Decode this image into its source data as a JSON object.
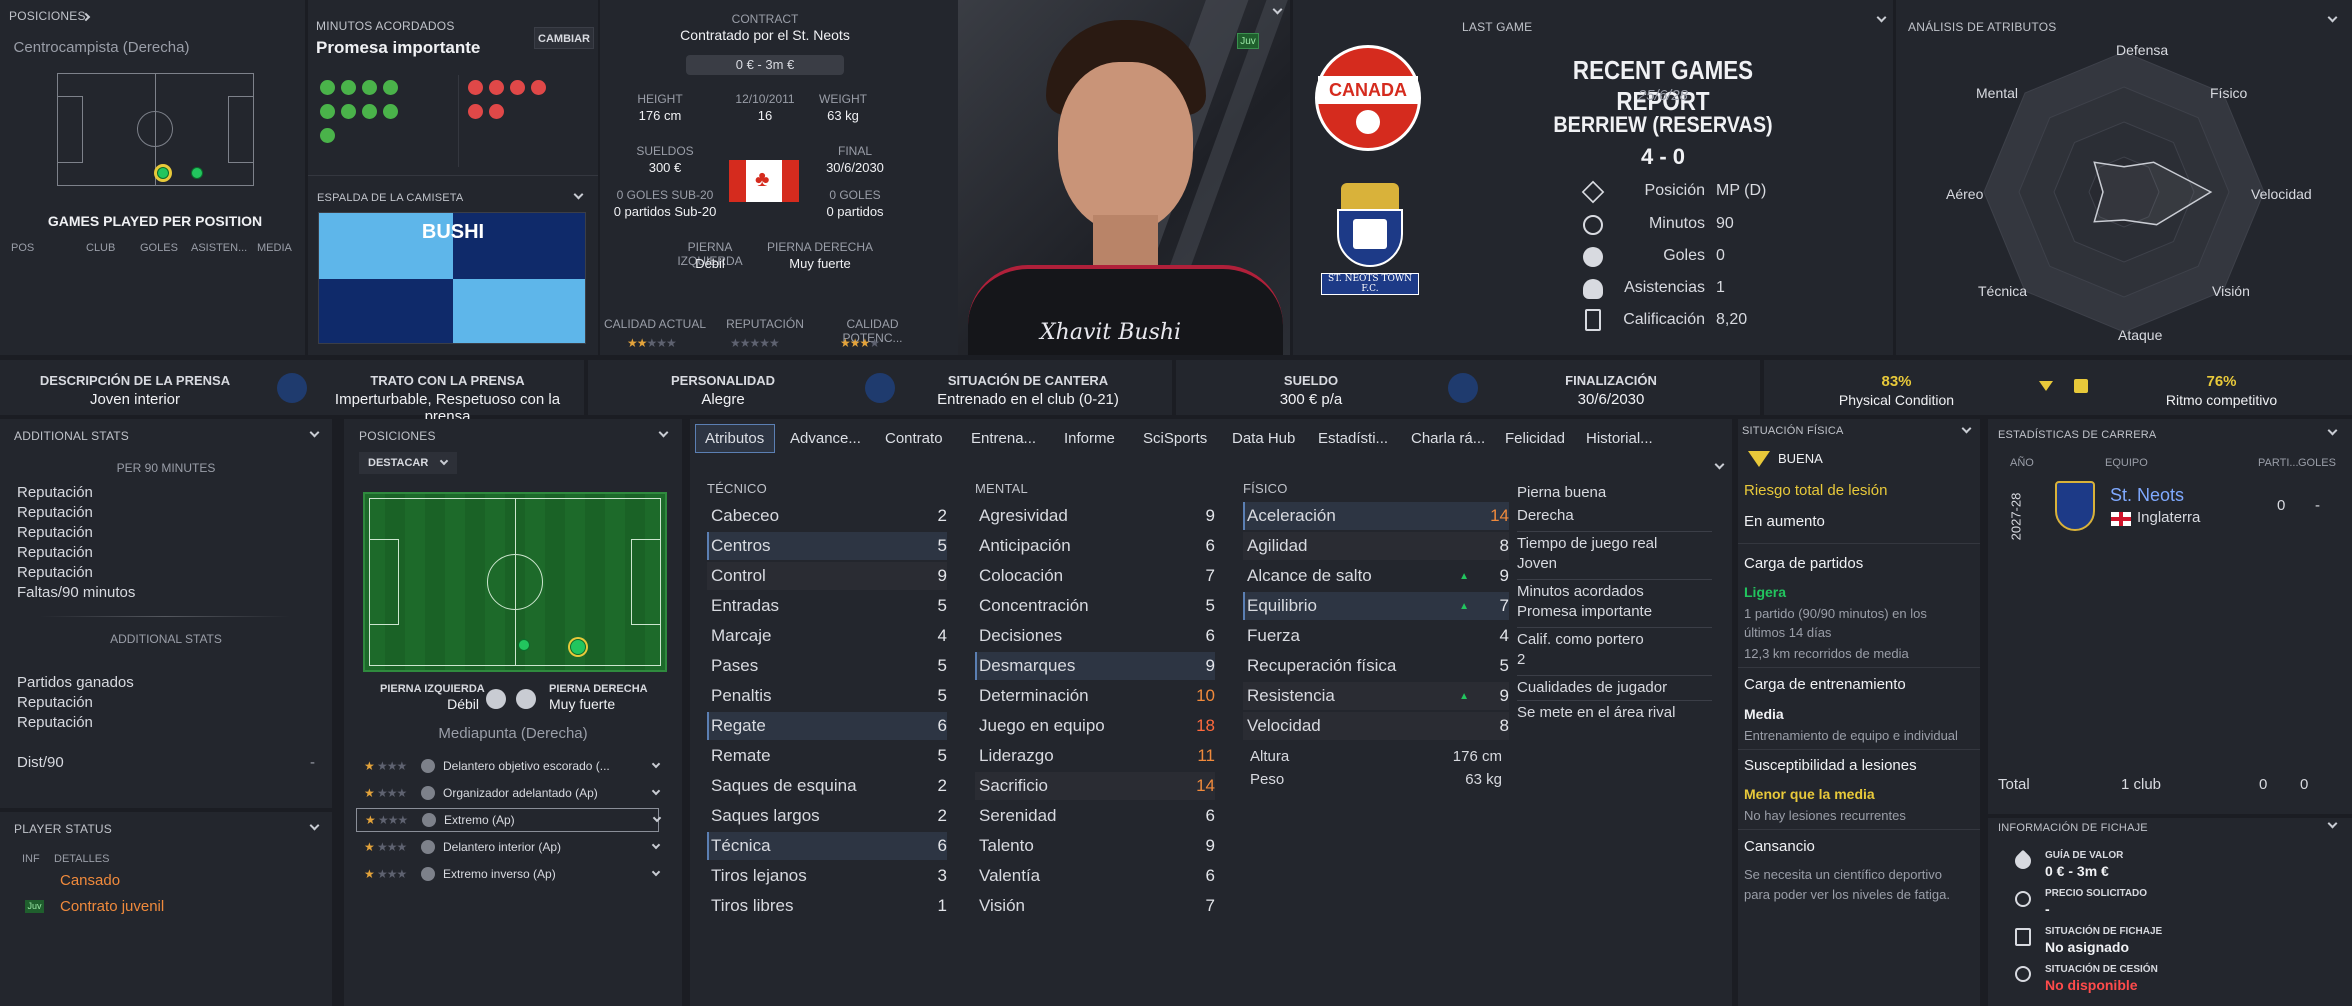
{
  "positions_panel": {
    "title": "POSICIONES",
    "position_name": "Centrocampista (Derecha)",
    "games_per_position": "GAMES PLAYED PER POSITION",
    "cols": [
      "POS",
      "CLUB",
      "GOLES",
      "ASISTEN...",
      "MEDIA"
    ]
  },
  "minutes": {
    "title": "MINUTOS ACORDADOS",
    "value": "Promesa importante",
    "change_button": "CAMBIAR"
  },
  "shirt": {
    "title": "ESPALDA DE LA CAMISETA",
    "name": "BUSHI"
  },
  "contract": {
    "title": "CONTRACT",
    "club_line": "Contratado por el St. Neots",
    "value_pill": "0 € - 3m €",
    "height_label": "HEIGHT",
    "height": "176 cm",
    "dob_label": "12/10/2011",
    "age": "16",
    "weight_label": "WEIGHT",
    "weight": "63 kg",
    "wage_label": "SUELDOS",
    "wage": "300 €",
    "end_label": "FINAL",
    "end": "30/6/2030",
    "u20_label": "0 GOLES SUB-20",
    "u20_value": "0 partidos Sub-20",
    "goals_label": "0 GOLES",
    "goals_value": "0 partidos",
    "left_foot_label": "PIERNA IZQUIERDA",
    "left_foot": "Débil",
    "right_foot_label": "PIERNA DERECHA",
    "right_foot": "Muy fuerte",
    "ca_label": "CALIDAD ACTUAL",
    "rep_label": "REPUTACIÓN",
    "pa_label": "CALIDAD POTENC..."
  },
  "photo": {
    "badge": "Juv",
    "signature": "Xhavit Bushi"
  },
  "last_game": {
    "title": "LAST GAME",
    "heading": "RECENT GAMES REPORT",
    "date": "25/6/28",
    "opponent": "BERRIEW (RESERVAS)",
    "score": "4 - 0",
    "rows": [
      {
        "label": "Posición",
        "value": "MP (D)"
      },
      {
        "label": "Minutos",
        "value": "90"
      },
      {
        "label": "Goles",
        "value": "0"
      },
      {
        "label": "Asistencias",
        "value": "1"
      },
      {
        "label": "Calificación",
        "value": "8,20"
      }
    ],
    "canada_text": "CANADA",
    "club_crest_text": "ST. NEOTS TOWN F.C."
  },
  "attr_analysis": {
    "title": "ANÁLISIS DE ATRIBUTOS",
    "labels": [
      "Defensa",
      "Físico",
      "Velocidad",
      "Visión",
      "Ataque",
      "Técnica",
      "Aéreo",
      "Mental"
    ],
    "values": [
      0.18,
      0.3,
      0.62,
      0.33,
      0.2,
      0.3,
      0.15,
      0.3
    ]
  },
  "info_bar": {
    "press_label": "DESCRIPCIÓN DE LA PRENSA",
    "press": "Joven interior",
    "press_treat_label": "TRATO CON LA PRENSA",
    "press_treat": "Imperturbable, Respetuoso con la prensa",
    "personality_label": "PERSONALIDAD",
    "personality": "Alegre",
    "youth_label": "SITUACIÓN DE CANTERA",
    "youth": "Entrenado en el club (0-21)",
    "salary_label": "SUELDO",
    "salary": "300 € p/a",
    "expiry_label": "FINALIZACIÓN",
    "expiry": "30/6/2030",
    "condition_pct": "83%",
    "condition_label": "Physical Condition",
    "sharp_pct": "76%",
    "sharp_label": "Ritmo competitivo"
  },
  "additional_stats": {
    "title": "ADDITIONAL STATS",
    "sub1": "PER 90 MINUTES",
    "items1": [
      "Reputación",
      "Reputación",
      "Reputación",
      "Reputación",
      "Reputación",
      "Faltas/90 minutos"
    ],
    "sub2": "ADDITIONAL STATS",
    "items2": [
      "Partidos ganados",
      "Reputación",
      "Reputación"
    ],
    "dist_label": "Dist/90",
    "dist_value": "-"
  },
  "player_status": {
    "title": "PLAYER STATUS",
    "col1": "INF",
    "col2": "DETALLES",
    "row1": "Cansado",
    "row2_badge": "Juv",
    "row2": "Contrato juvenil"
  },
  "positions2": {
    "title": "POSICIONES",
    "dropdown": "DESTACAR",
    "left_label": "PIERNA IZQUIERDA",
    "left_val": "Débil",
    "right_label": "PIERNA DERECHA",
    "right_val": "Muy fuerte",
    "position_name": "Mediapunta (Derecha)",
    "roles": [
      "Delantero objetivo escorado (...",
      "Organizador adelantado (Ap)",
      "Extremo (Ap)",
      "Delantero interior (Ap)",
      "Extremo inverso (Ap)"
    ]
  },
  "tabs": [
    "Atributos",
    "Advance...",
    "Contrato",
    "Entrena...",
    "Informe",
    "SciSports",
    "Data Hub",
    "Estadísti...",
    "Charla rá...",
    "Felicidad",
    "Historial..."
  ],
  "attributes": {
    "technical_title": "TÉCNICO",
    "mental_title": "MENTAL",
    "physical_title": "FÍSICO",
    "technical": [
      {
        "n": "Cabeceo",
        "v": "2"
      },
      {
        "n": "Centros",
        "v": "5"
      },
      {
        "n": "Control",
        "v": "9"
      },
      {
        "n": "Entradas",
        "v": "5"
      },
      {
        "n": "Marcaje",
        "v": "4"
      },
      {
        "n": "Pases",
        "v": "5"
      },
      {
        "n": "Penaltis",
        "v": "5"
      },
      {
        "n": "Regate",
        "v": "6"
      },
      {
        "n": "Remate",
        "v": "5"
      },
      {
        "n": "Saques de esquina",
        "v": "2"
      },
      {
        "n": "Saques largos",
        "v": "2"
      },
      {
        "n": "Técnica",
        "v": "6"
      },
      {
        "n": "Tiros lejanos",
        "v": "3"
      },
      {
        "n": "Tiros libres",
        "v": "1"
      }
    ],
    "mental": [
      {
        "n": "Agresividad",
        "v": "9"
      },
      {
        "n": "Anticipación",
        "v": "6"
      },
      {
        "n": "Colocación",
        "v": "7"
      },
      {
        "n": "Concentración",
        "v": "5"
      },
      {
        "n": "Decisiones",
        "v": "6"
      },
      {
        "n": "Desmarques",
        "v": "9"
      },
      {
        "n": "Determinación",
        "v": "10"
      },
      {
        "n": "Juego en equipo",
        "v": "18"
      },
      {
        "n": "Liderazgo",
        "v": "11"
      },
      {
        "n": "Sacrificio",
        "v": "14"
      },
      {
        "n": "Serenidad",
        "v": "6"
      },
      {
        "n": "Talento",
        "v": "9"
      },
      {
        "n": "Valentía",
        "v": "6"
      },
      {
        "n": "Visión",
        "v": "7"
      }
    ],
    "physical": [
      {
        "n": "Aceleración",
        "v": "14"
      },
      {
        "n": "Agilidad",
        "v": "8"
      },
      {
        "n": "Alcance de salto",
        "v": "9"
      },
      {
        "n": "Equilibrio",
        "v": "7"
      },
      {
        "n": "Fuerza",
        "v": "4"
      },
      {
        "n": "Recuperación física",
        "v": "5"
      },
      {
        "n": "Resistencia",
        "v": "9"
      },
      {
        "n": "Velocidad",
        "v": "8"
      }
    ],
    "height_label": "Altura",
    "height": "176 cm",
    "weight_label": "Peso",
    "weight": "63 kg",
    "side_info": [
      "Pierna buena",
      "Derecha",
      "Tiempo de juego real",
      "Joven",
      "Minutos acordados",
      "Promesa importante",
      "Calif. como portero",
      "2",
      "Cualidades de jugador",
      "Se mete en el área rival"
    ]
  },
  "physical_status": {
    "title": "SITUACIÓN FÍSICA",
    "status": "BUENA",
    "injury_risk": "Riesgo total de lesión",
    "trend": "En aumento",
    "load_title": "Carga de partidos",
    "load_level": "Ligera",
    "load_text1": "1 partido (90/90 minutos) en los",
    "load_text2": "últimos 14 días",
    "load_text3": "12,3 km recorridos de media",
    "train_title": "Carga de entrenamiento",
    "train_level": "Media",
    "train_text": "Entrenamiento de equipo e individual",
    "susc_title": "Susceptibilidad a lesiones",
    "susc_level": "Menor que la media",
    "susc_text": "No hay lesiones recurrentes",
    "fatigue_title": "Cansancio",
    "fatigue_text1": "Se necesita un científico deportivo",
    "fatigue_text2": "para poder ver los niveles de fatiga."
  },
  "career": {
    "title": "ESTADÍSTICAS DE CARRERA",
    "col_year": "AÑO",
    "col_team": "EQUIPO",
    "col_apps": "PARTI...",
    "col_goals": "GOLES",
    "season": "2027-28",
    "team": "St. Neots",
    "country": "Inglaterra",
    "apps": "0",
    "goals": "-",
    "total_label": "Total",
    "total_clubs": "1 club",
    "total_apps": "0",
    "total_goals": "0"
  },
  "transfer": {
    "title": "INFORMACIÓN DE FICHAJE",
    "value_label": "GUÍA DE VALOR",
    "value": "0 € - 3m €",
    "asking_label": "PRECIO SOLICITADO",
    "asking": "-",
    "status_label": "SITUACIÓN DE FICHAJE",
    "status": "No asignado",
    "loan_label": "SITUACIÓN DE CESIÓN",
    "loan": "No disponible"
  },
  "colors": {
    "accent": "#5b7fb3",
    "orange": "#f08a3c",
    "red": "#ff4b4b",
    "green": "#22c55e",
    "yellow": "#e8c93a"
  }
}
